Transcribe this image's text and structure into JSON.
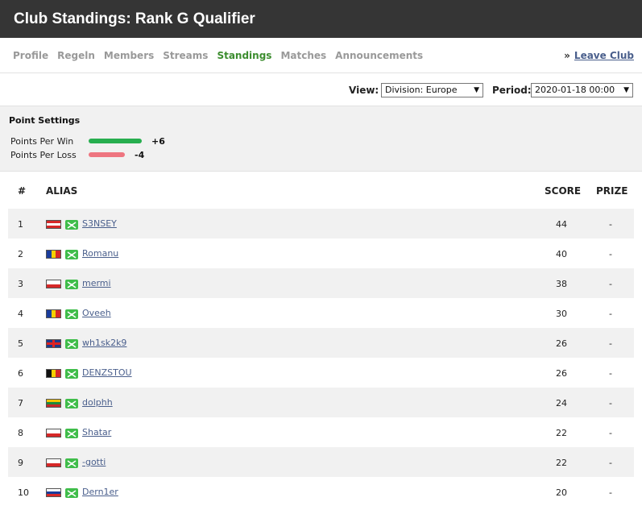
{
  "title": "Club Standings: Rank G Qualifier",
  "nav": {
    "tabs": [
      {
        "label": "Profile",
        "active": false
      },
      {
        "label": "Regeln",
        "active": false
      },
      {
        "label": "Members",
        "active": false
      },
      {
        "label": "Streams",
        "active": false
      },
      {
        "label": "Standings",
        "active": true
      },
      {
        "label": "Matches",
        "active": false
      },
      {
        "label": "Announcements",
        "active": false
      }
    ],
    "leave_prefix": "»",
    "leave_label": "Leave Club"
  },
  "filters": {
    "view_label": "View:",
    "view_value": "Division: Europe",
    "period_label": "Period:",
    "period_value": "2020-01-18 00:00"
  },
  "point_settings": {
    "title": "Point Settings",
    "win_label": "Points Per Win",
    "win_value": "+6",
    "loss_label": "Points Per Loss",
    "loss_value": "-4",
    "win_color": "#27ae4f",
    "loss_color": "#ee7580"
  },
  "table": {
    "headers": {
      "rank": "#",
      "alias": "ALIAS",
      "score": "SCORE",
      "prize": "PRIZE"
    },
    "rows": [
      {
        "rank": "1",
        "flag": "austria",
        "alias": "S3NSEY",
        "score": "44",
        "prize": "-"
      },
      {
        "rank": "2",
        "flag": "romania",
        "alias": "Romanu",
        "score": "40",
        "prize": "-"
      },
      {
        "rank": "3",
        "flag": "poland",
        "alias": "mermi",
        "score": "38",
        "prize": "-"
      },
      {
        "rank": "4",
        "flag": "romania",
        "alias": "Oveeh",
        "score": "30",
        "prize": "-"
      },
      {
        "rank": "5",
        "flag": "united-kingdom",
        "alias": "wh1sk2k9",
        "score": "26",
        "prize": "-"
      },
      {
        "rank": "6",
        "flag": "belgium",
        "alias": "DENZSTOU",
        "score": "26",
        "prize": "-"
      },
      {
        "rank": "7",
        "flag": "lithuania",
        "alias": "dolphh",
        "score": "24",
        "prize": "-"
      },
      {
        "rank": "8",
        "flag": "poland",
        "alias": "Shatar",
        "score": "22",
        "prize": "-"
      },
      {
        "rank": "9",
        "flag": "poland",
        "alias": "-gotti",
        "score": "22",
        "prize": "-"
      },
      {
        "rank": "10",
        "flag": "russia",
        "alias": "Dern1er",
        "score": "20",
        "prize": "-"
      }
    ]
  }
}
